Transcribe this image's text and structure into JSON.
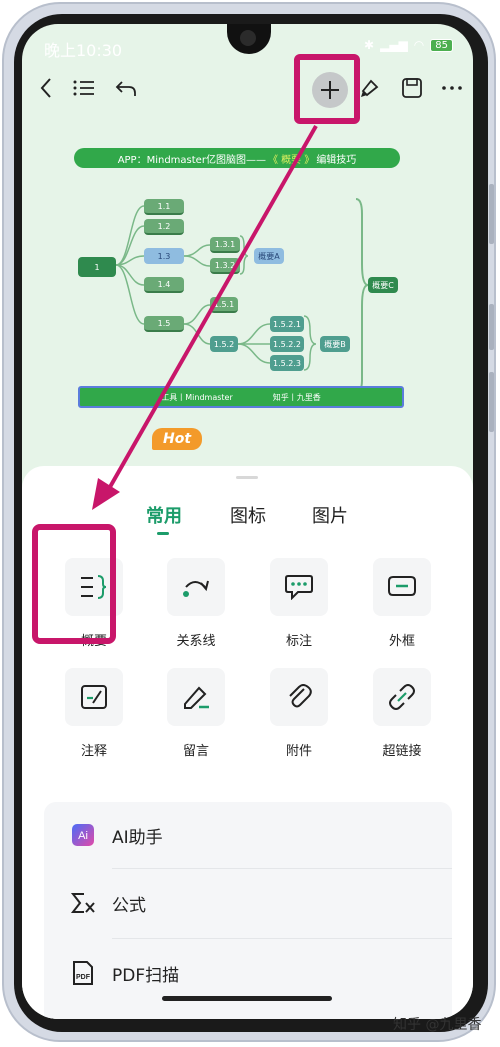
{
  "status": {
    "time": "晚上10:30",
    "battery": "85"
  },
  "mindmap": {
    "title_prefix": "APP：Mindmaster亿图脑图——",
    "title_highlight": "《 概要 》",
    "title_suffix": "编辑技巧",
    "root": "1",
    "nodes": [
      "1.1",
      "1.2",
      "1.3",
      "1.4",
      "1.5",
      "1.3.1",
      "1.3.2",
      "1.5.1",
      "1.5.2",
      "1.5.2.1",
      "1.5.2.2",
      "1.5.2.3"
    ],
    "summary_a": "概要A",
    "summary_b": "概要B",
    "summary_c": "概要C",
    "footer_left": "工具丨Mindmaster",
    "footer_right": "知乎丨九里香"
  },
  "sheet": {
    "tabs": [
      "常用",
      "图标",
      "图片"
    ],
    "tools": [
      {
        "label": "概要",
        "icon": "summary-icon"
      },
      {
        "label": "关系线",
        "icon": "relation-line-icon"
      },
      {
        "label": "标注",
        "icon": "callout-icon"
      },
      {
        "label": "外框",
        "icon": "boundary-icon"
      },
      {
        "label": "注释",
        "icon": "note-icon"
      },
      {
        "label": "留言",
        "icon": "comment-icon"
      },
      {
        "label": "附件",
        "icon": "attachment-icon"
      },
      {
        "label": "超链接",
        "icon": "hyperlink-icon"
      }
    ],
    "list": [
      {
        "label": "AI助手",
        "icon": "ai-assistant-icon",
        "badge": "Hot"
      },
      {
        "label": "公式",
        "icon": "formula-icon"
      },
      {
        "label": "PDF扫描",
        "icon": "pdf-scan-icon"
      }
    ]
  },
  "watermark": "知乎 @九里香",
  "colors": {
    "accent": "#1c9c6a",
    "highlight": "#c8166a",
    "map_green": "#31a84a",
    "hot": "#f39a2a"
  }
}
